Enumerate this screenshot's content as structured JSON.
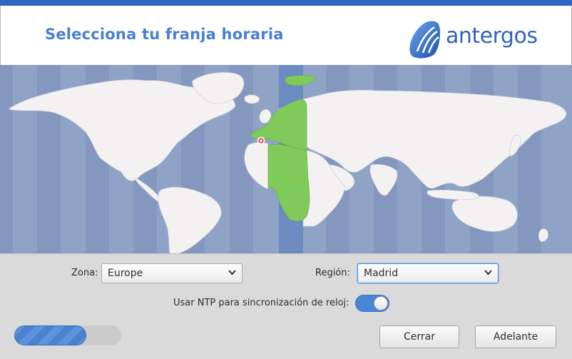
{
  "header": {
    "title": "Selecciona tu franja horaria",
    "logo_text": "antergos"
  },
  "map": {
    "ocean_color": "#8fa3c7",
    "land_color": "#f3f1f1",
    "highlight_color": "#7ecb59",
    "timezone_band_color": "#6d8bc0",
    "marker_color": "#e25c5c",
    "selected_location": "Madrid"
  },
  "form": {
    "zone_label": "Zona:",
    "zone_value": "Europe",
    "region_label": "Región:",
    "region_value": "Madrid",
    "ntp_label": "Usar NTP para sincronización de reloj:",
    "ntp_enabled": true
  },
  "progress": {
    "fraction": 0.67
  },
  "buttons": {
    "close_label": "Cerrar",
    "next_label": "Adelante"
  }
}
